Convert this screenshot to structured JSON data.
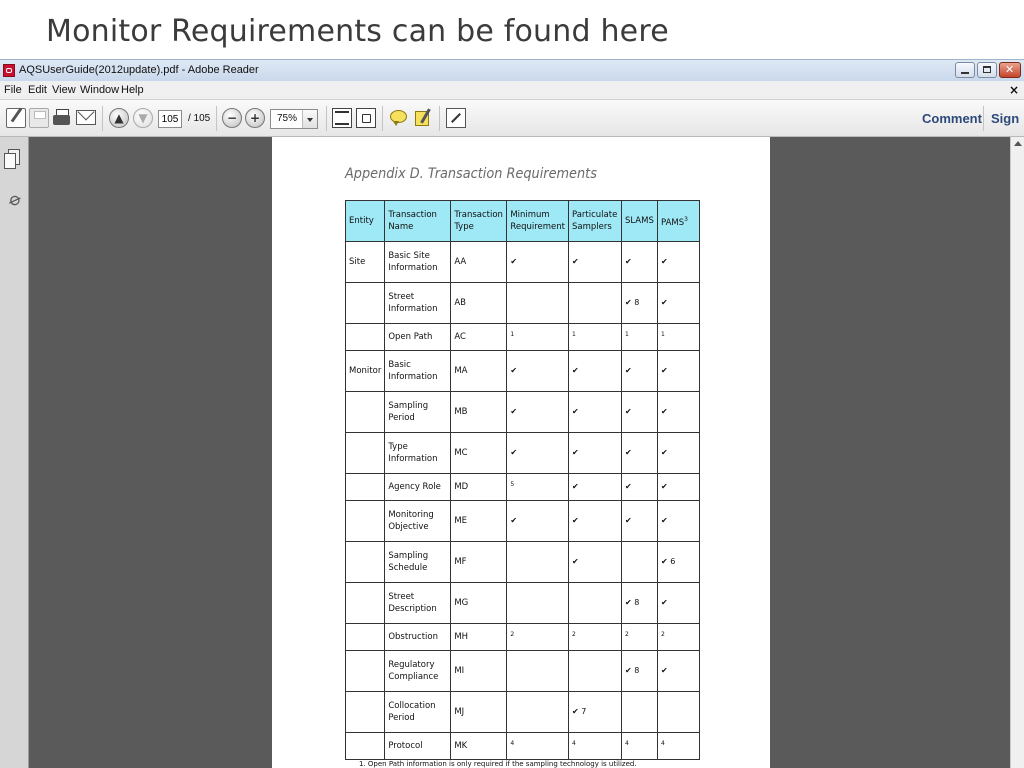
{
  "slide": {
    "title": "Monitor Requirements can be found here"
  },
  "window": {
    "title": "AQSUserGuide(2012update).pdf - Adobe Reader"
  },
  "menu": {
    "items": [
      "File",
      "Edit",
      "View",
      "Window",
      "Help"
    ],
    "close_glyph": "×"
  },
  "toolbar": {
    "prev_page_glyph": "▲",
    "next_page_glyph": "▼",
    "page_current": "105",
    "page_total": "/ 105",
    "zoom_out_glyph": "−",
    "zoom_in_glyph": "+",
    "zoom": "75%",
    "comment_label": "Comment",
    "sign_label": "Sign"
  },
  "document": {
    "heading": "Appendix D. Transaction Requirements",
    "columns": [
      "Entity",
      "Transaction Name",
      "Transaction Type",
      "Minimum Requirement",
      "Particulate Samplers",
      "SLAMS",
      "PAMS"
    ],
    "pams_footnote": "3",
    "rows": [
      {
        "entity": "Site",
        "name": "Basic Site Information",
        "type": "AA",
        "min": "✔",
        "part": "✔",
        "slams": "✔",
        "pams": "✔"
      },
      {
        "entity": "",
        "name": "Street Information",
        "type": "AB",
        "min": "",
        "part": "",
        "slams": "✔ 8",
        "pams": "✔"
      },
      {
        "entity": "",
        "name": "Open Path",
        "type": "AC",
        "min": "1",
        "part": "1",
        "slams": "1",
        "pams": "1"
      },
      {
        "entity": "Monitor",
        "name": "Basic Information",
        "type": "MA",
        "min": "✔",
        "part": "✔",
        "slams": "✔",
        "pams": "✔"
      },
      {
        "entity": "",
        "name": "Sampling Period",
        "type": "MB",
        "min": "✔",
        "part": "✔",
        "slams": "✔",
        "pams": "✔"
      },
      {
        "entity": "",
        "name": "Type Information",
        "type": "MC",
        "min": "✔",
        "part": "✔",
        "slams": "✔",
        "pams": "✔"
      },
      {
        "entity": "",
        "name": "Agency Role",
        "type": "MD",
        "min": "5",
        "part": "✔",
        "slams": "✔",
        "pams": "✔"
      },
      {
        "entity": "",
        "name": "Monitoring Objective",
        "type": "ME",
        "min": "✔",
        "part": "✔",
        "slams": "✔",
        "pams": "✔"
      },
      {
        "entity": "",
        "name": "Sampling Schedule",
        "type": "MF",
        "min": "",
        "part": "✔",
        "slams": "",
        "pams": "✔ 6"
      },
      {
        "entity": "",
        "name": "Street Description",
        "type": "MG",
        "min": "",
        "part": "",
        "slams": "✔ 8",
        "pams": "✔"
      },
      {
        "entity": "",
        "name": "Obstruction",
        "type": "MH",
        "min": "2",
        "part": "2",
        "slams": "2",
        "pams": "2"
      },
      {
        "entity": "",
        "name": "Regulatory Compliance",
        "type": "MI",
        "min": "",
        "part": "",
        "slams": "✔ 8",
        "pams": "✔"
      },
      {
        "entity": "",
        "name": "Collocation Period",
        "type": "MJ",
        "min": "",
        "part": "✔ 7",
        "slams": "",
        "pams": ""
      },
      {
        "entity": "",
        "name": "Protocol",
        "type": "MK",
        "min": "4",
        "part": "4",
        "slams": "4",
        "pams": "4"
      }
    ],
    "footnote": "1.    Open Path information is only required if the sampling technology is utilized."
  }
}
